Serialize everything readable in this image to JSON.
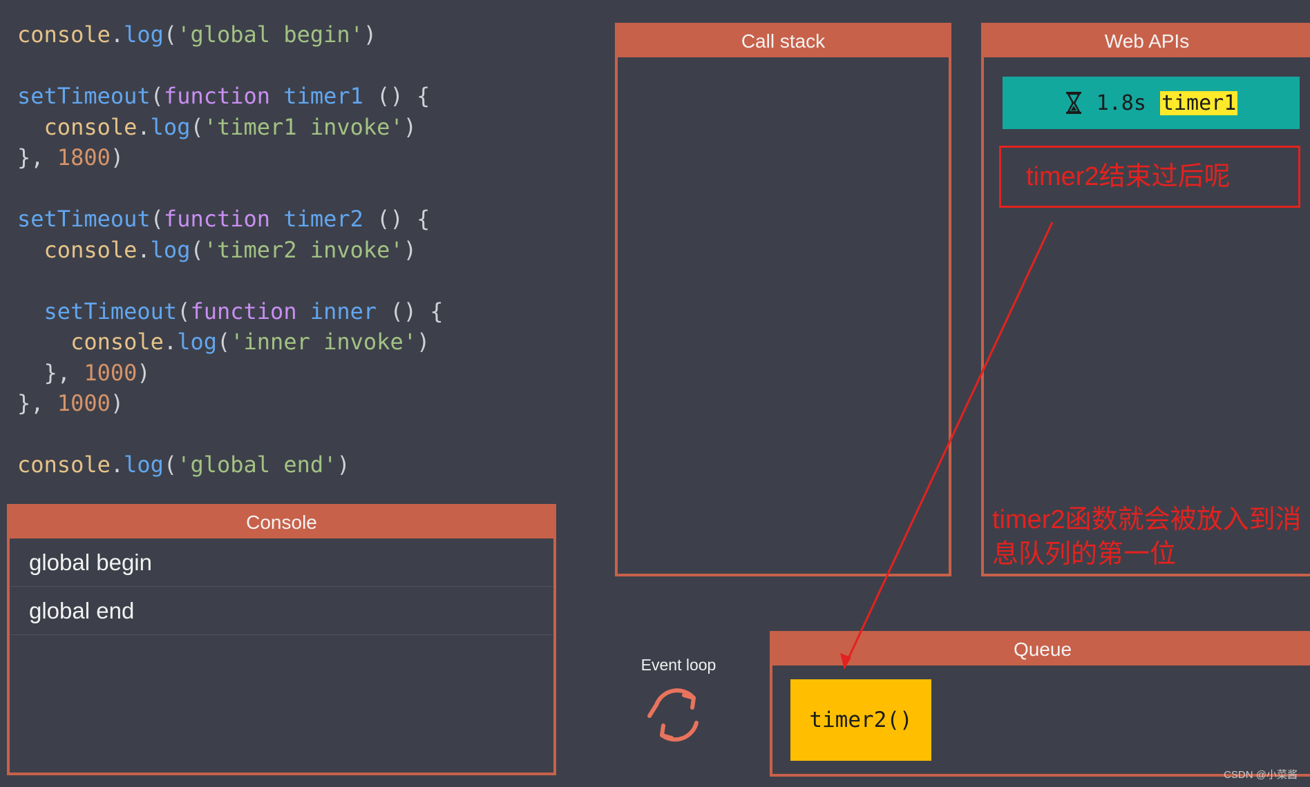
{
  "code": {
    "lines": [
      [
        {
          "t": "console",
          "c": "kw-obj"
        },
        {
          "t": ".",
          "c": "punc"
        },
        {
          "t": "log",
          "c": "kw-fn"
        },
        {
          "t": "(",
          "c": "punc"
        },
        {
          "t": "'global begin'",
          "c": "str"
        },
        {
          "t": ")",
          "c": "punc"
        }
      ],
      [],
      [
        {
          "t": "setTimeout",
          "c": "kw-fn"
        },
        {
          "t": "(",
          "c": "punc"
        },
        {
          "t": "function",
          "c": "kw-func"
        },
        {
          "t": " ",
          "c": "punc"
        },
        {
          "t": "timer1",
          "c": "kw-fn"
        },
        {
          "t": " () {",
          "c": "punc"
        }
      ],
      [
        {
          "t": "  console",
          "c": "kw-obj"
        },
        {
          "t": ".",
          "c": "punc"
        },
        {
          "t": "log",
          "c": "kw-fn"
        },
        {
          "t": "(",
          "c": "punc"
        },
        {
          "t": "'timer1 invoke'",
          "c": "str"
        },
        {
          "t": ")",
          "c": "punc"
        }
      ],
      [
        {
          "t": "}, ",
          "c": "punc"
        },
        {
          "t": "1800",
          "c": "num"
        },
        {
          "t": ")",
          "c": "punc"
        }
      ],
      [],
      [
        {
          "t": "setTimeout",
          "c": "kw-fn"
        },
        {
          "t": "(",
          "c": "punc"
        },
        {
          "t": "function",
          "c": "kw-func"
        },
        {
          "t": " ",
          "c": "punc"
        },
        {
          "t": "timer2",
          "c": "kw-fn"
        },
        {
          "t": " () {",
          "c": "punc"
        }
      ],
      [
        {
          "t": "  console",
          "c": "kw-obj"
        },
        {
          "t": ".",
          "c": "punc"
        },
        {
          "t": "log",
          "c": "kw-fn"
        },
        {
          "t": "(",
          "c": "punc"
        },
        {
          "t": "'timer2 invoke'",
          "c": "str"
        },
        {
          "t": ")",
          "c": "punc"
        }
      ],
      [],
      [
        {
          "t": "  setTimeout",
          "c": "kw-fn"
        },
        {
          "t": "(",
          "c": "punc"
        },
        {
          "t": "function",
          "c": "kw-func"
        },
        {
          "t": " ",
          "c": "punc"
        },
        {
          "t": "inner",
          "c": "kw-fn"
        },
        {
          "t": " () {",
          "c": "punc"
        }
      ],
      [
        {
          "t": "    console",
          "c": "kw-obj"
        },
        {
          "t": ".",
          "c": "punc"
        },
        {
          "t": "log",
          "c": "kw-fn"
        },
        {
          "t": "(",
          "c": "punc"
        },
        {
          "t": "'inner invoke'",
          "c": "str"
        },
        {
          "t": ")",
          "c": "punc"
        }
      ],
      [
        {
          "t": "  }, ",
          "c": "punc"
        },
        {
          "t": "1000",
          "c": "num"
        },
        {
          "t": ")",
          "c": "punc"
        }
      ],
      [
        {
          "t": "}, ",
          "c": "punc"
        },
        {
          "t": "1000",
          "c": "num"
        },
        {
          "t": ")",
          "c": "punc"
        }
      ],
      [],
      [
        {
          "t": "console",
          "c": "kw-obj"
        },
        {
          "t": ".",
          "c": "punc"
        },
        {
          "t": "log",
          "c": "kw-fn"
        },
        {
          "t": "(",
          "c": "punc"
        },
        {
          "t": "'global end'",
          "c": "str"
        },
        {
          "t": ")",
          "c": "punc"
        }
      ]
    ]
  },
  "call_stack": {
    "title": "Call stack"
  },
  "web_apis": {
    "title": "Web APIs",
    "timer": {
      "icon": "hourglass-icon",
      "time": "1.8s",
      "name": "timer1"
    }
  },
  "annotations": {
    "box_note": "timer2结束过后呢",
    "queue_note": "timer2函数就会被放入到消息队列的第一位"
  },
  "console": {
    "title": "Console",
    "lines": [
      "global begin",
      "global end"
    ]
  },
  "event_loop": {
    "label": "Event loop",
    "icon": "loop-arrows-icon"
  },
  "queue": {
    "title": "Queue",
    "items": [
      "timer2()"
    ]
  },
  "watermark": "CSDN @小菜酱",
  "colors": {
    "background": "#3d404a",
    "panel_accent": "#c8614a",
    "timer_block": "#13a89e",
    "queue_item": "#ffbf00",
    "annotation_red": "#e3221f",
    "highlight_yellow": "#ffe92b"
  }
}
